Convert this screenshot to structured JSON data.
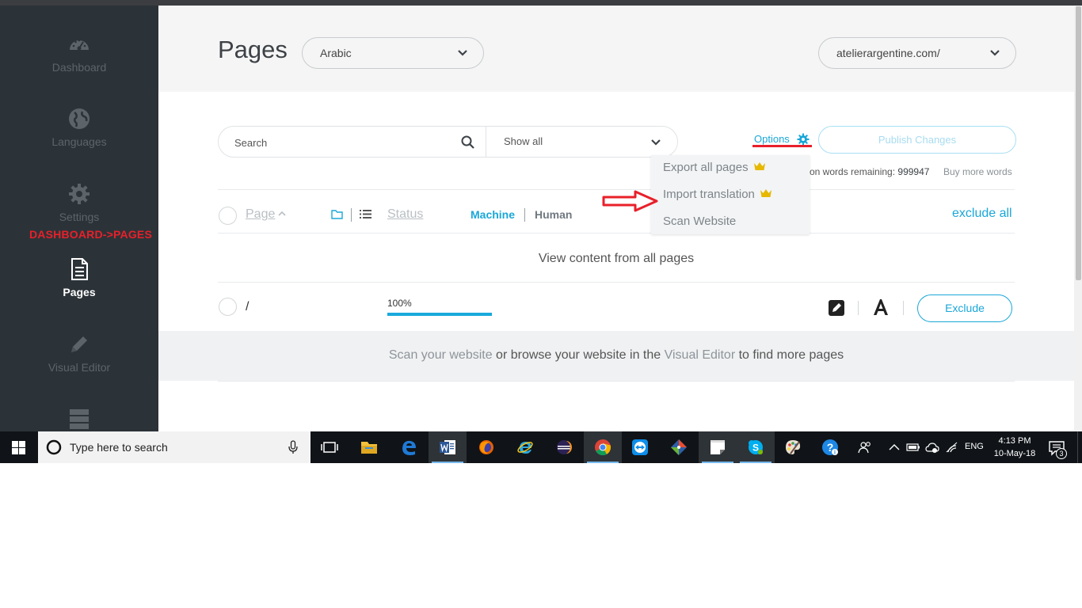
{
  "sidebar": {
    "items": [
      {
        "label": "Dashboard",
        "icon": "dashboard-icon"
      },
      {
        "label": "Languages",
        "icon": "globe-icon"
      },
      {
        "label": "Settings",
        "icon": "gear-icon"
      },
      {
        "label": "Pages",
        "icon": "document-icon",
        "active": true
      },
      {
        "label": "Visual Editor",
        "icon": "pencil-icon"
      },
      {
        "label": "",
        "icon": "server-icon"
      }
    ],
    "annotation": "DASHBOARD->PAGES"
  },
  "header": {
    "title": "Pages",
    "language_select": "Arabic",
    "site_select": "atelierargentine.com/"
  },
  "toolbar": {
    "search_placeholder": "Search",
    "filter_select": "Show all",
    "options_label": "Options",
    "publish_label": "Publish Changes",
    "words_remaining_prefix": "on words remaining:",
    "words_remaining_value": "999947",
    "buy_more_words": "Buy more words"
  },
  "options_menu": {
    "items": [
      {
        "label": "Export all pages",
        "premium": true
      },
      {
        "label": "Import translation",
        "premium": true
      },
      {
        "label": "Scan Website",
        "premium": false
      }
    ]
  },
  "table": {
    "headers": {
      "page": "Page",
      "status": "Status",
      "machine": "Machine",
      "human": "Human",
      "exclude_all": "exclude all"
    },
    "view_all": "View content from all pages",
    "rows": [
      {
        "path": "/",
        "progress_label": "100%",
        "progress": 1.0,
        "exclude_label": "Exclude"
      }
    ]
  },
  "scan_hint": {
    "link1": "Scan your website",
    "text1": " or browse your website in the ",
    "link2": "Visual Editor",
    "text2": " to find more pages"
  },
  "taskbar": {
    "search_placeholder": "Type here to search",
    "language": "ENG",
    "time": "4:13 PM",
    "date": "10-May-18",
    "notification_count": "3"
  },
  "colors": {
    "accent": "#1aa7d8",
    "sidebar_bg": "#2c3338",
    "annotation_red": "#e8202a",
    "crown": "#e6b800"
  }
}
